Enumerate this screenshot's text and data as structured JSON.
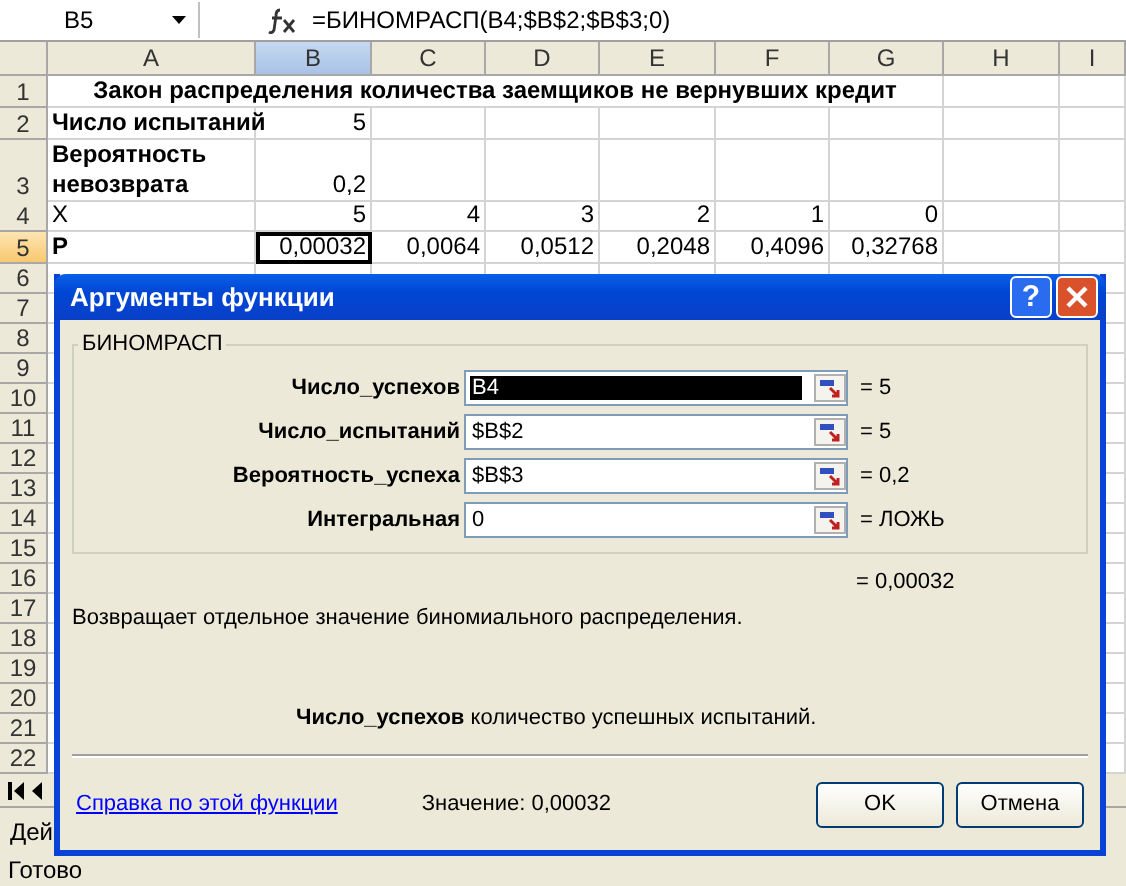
{
  "formula_bar": {
    "name_box": "B5",
    "formula": "=БИНОМРАСП(B4;$B$2;$B$3;0)"
  },
  "columns": [
    {
      "label": "A",
      "selected": false
    },
    {
      "label": "B",
      "selected": true
    },
    {
      "label": "C",
      "selected": false
    },
    {
      "label": "D",
      "selected": false
    },
    {
      "label": "E",
      "selected": false
    },
    {
      "label": "F",
      "selected": false
    },
    {
      "label": "G",
      "selected": false
    },
    {
      "label": "H",
      "selected": false
    },
    {
      "label": "I",
      "selected": false
    }
  ],
  "rows": [
    {
      "header": "1",
      "selected": false,
      "kind": "title",
      "title": "Закон распределения количества заемщиков не вернувших кредит"
    },
    {
      "header": "2",
      "selected": false,
      "kind": "cells",
      "cells": [
        {
          "text": "Число испытаний",
          "kind": "label",
          "selected": false
        },
        {
          "text": "5",
          "kind": "number",
          "selected": false
        }
      ]
    },
    {
      "header": "3",
      "selected": false,
      "kind": "tall",
      "cells": [
        {
          "text": "Вероятность невозврата",
          "kind": "label",
          "selected": false
        },
        {
          "text": "0,2",
          "kind": "number",
          "selected": false
        }
      ]
    },
    {
      "header": "4",
      "selected": false,
      "kind": "cells",
      "cells": [
        {
          "text": "X",
          "kind": "text",
          "selected": false
        },
        {
          "text": "5",
          "kind": "number",
          "selected": false
        },
        {
          "text": "4",
          "kind": "number",
          "selected": false
        },
        {
          "text": "3",
          "kind": "number",
          "selected": false
        },
        {
          "text": "2",
          "kind": "number",
          "selected": false
        },
        {
          "text": "1",
          "kind": "number",
          "selected": false
        },
        {
          "text": "0",
          "kind": "number",
          "selected": false
        }
      ]
    },
    {
      "header": "5",
      "selected": true,
      "kind": "cells",
      "cells": [
        {
          "text": "P",
          "kind": "label",
          "selected": false
        },
        {
          "text": "0,00032",
          "kind": "number",
          "selected": true
        },
        {
          "text": "0,0064",
          "kind": "number",
          "selected": false
        },
        {
          "text": "0,0512",
          "kind": "number",
          "selected": false
        },
        {
          "text": "0,2048",
          "kind": "number",
          "selected": false
        },
        {
          "text": "0,4096",
          "kind": "number",
          "selected": false
        },
        {
          "text": "0,32768",
          "kind": "number",
          "selected": false
        }
      ]
    },
    {
      "header": "6",
      "selected": false,
      "kind": "empty"
    },
    {
      "header": "7",
      "selected": false,
      "kind": "empty"
    },
    {
      "header": "8",
      "selected": false,
      "kind": "empty"
    },
    {
      "header": "9",
      "selected": false,
      "kind": "empty"
    },
    {
      "header": "10",
      "selected": false,
      "kind": "empty"
    },
    {
      "header": "11",
      "selected": false,
      "kind": "empty"
    },
    {
      "header": "12",
      "selected": false,
      "kind": "empty"
    },
    {
      "header": "13",
      "selected": false,
      "kind": "empty"
    },
    {
      "header": "14",
      "selected": false,
      "kind": "empty"
    },
    {
      "header": "15",
      "selected": false,
      "kind": "empty"
    },
    {
      "header": "16",
      "selected": false,
      "kind": "empty"
    },
    {
      "header": "17",
      "selected": false,
      "kind": "empty"
    },
    {
      "header": "18",
      "selected": false,
      "kind": "empty"
    },
    {
      "header": "19",
      "selected": false,
      "kind": "empty"
    },
    {
      "header": "20",
      "selected": false,
      "kind": "empty"
    },
    {
      "header": "21",
      "selected": false,
      "kind": "empty"
    },
    {
      "header": "22",
      "selected": false,
      "kind": "empty"
    }
  ],
  "sheet_tab": "Дей",
  "status_bar": "Готово",
  "dialog": {
    "title": "Аргументы функции",
    "help_button": "?",
    "function_name": "БИНОМРАСП",
    "args": [
      {
        "label": "Число_успехов",
        "value": "B4",
        "result": "= 5",
        "selected": true
      },
      {
        "label": "Число_испытаний",
        "value": "$B$2",
        "result": "= 5",
        "selected": false
      },
      {
        "label": "Вероятность_успеха",
        "value": "$B$3",
        "result": "= 0,2",
        "selected": false
      },
      {
        "label": "Интегральная",
        "value": "0",
        "result": "= ЛОЖЬ",
        "selected": false
      }
    ],
    "formula_result": "= 0,00032",
    "description": "Возвращает отдельное значение биномиального распределения.",
    "arg_description": "**Число_успехов**  количество успешных испытаний.",
    "help_link": "Справка по этой функции",
    "value": "Значение: 0,00032",
    "buttons": [
      "OK",
      "Отмена"
    ]
  }
}
